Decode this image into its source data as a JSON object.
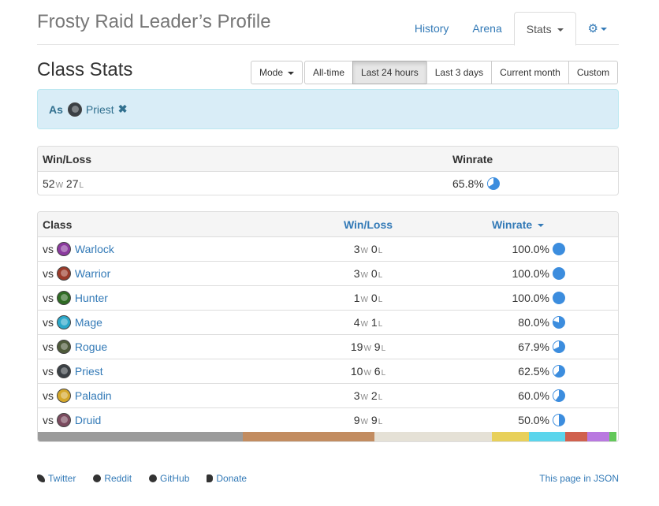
{
  "header": {
    "title": "Frosty Raid Leader’s Profile",
    "tabs": [
      {
        "label": "History"
      },
      {
        "label": "Arena"
      },
      {
        "label": "Stats"
      }
    ],
    "settings_icon": "gear-icon"
  },
  "toolbar": {
    "section_title": "Class Stats",
    "mode_label": "Mode",
    "ranges": [
      "All-time",
      "Last 24 hours",
      "Last 3 days",
      "Current month",
      "Custom"
    ],
    "active_range": "Last 24 hours"
  },
  "filter": {
    "as_label": "As",
    "class_name": "Priest",
    "class_icon": "priest-icon",
    "remove_icon": "✖"
  },
  "summary": {
    "headers": {
      "winloss": "Win/Loss",
      "winrate": "Winrate"
    },
    "wins": "52",
    "losses": "27",
    "win_unit": "W",
    "loss_unit": "L",
    "winrate": "65.8%",
    "winrate_fraction": 0.658
  },
  "classes": {
    "headers": {
      "class": "Class",
      "winloss": "Win/Loss",
      "winrate": "Winrate"
    },
    "vs_label": "vs",
    "rows": [
      {
        "name": "Warlock",
        "icon": "warlock-icon",
        "color": "#8b3a9e",
        "wins": "3",
        "losses": "0",
        "winrate": "100.0%",
        "fraction": 1.0
      },
      {
        "name": "Warrior",
        "icon": "warrior-icon",
        "color": "#9a3b2a",
        "wins": "3",
        "losses": "0",
        "winrate": "100.0%",
        "fraction": 1.0
      },
      {
        "name": "Hunter",
        "icon": "hunter-icon",
        "color": "#2f6b24",
        "wins": "1",
        "losses": "0",
        "winrate": "100.0%",
        "fraction": 1.0
      },
      {
        "name": "Mage",
        "icon": "mage-icon",
        "color": "#2aa7c9",
        "wins": "4",
        "losses": "1",
        "winrate": "80.0%",
        "fraction": 0.8
      },
      {
        "name": "Rogue",
        "icon": "rogue-icon",
        "color": "#4e5a3a",
        "wins": "19",
        "losses": "9",
        "winrate": "67.9%",
        "fraction": 0.679
      },
      {
        "name": "Priest",
        "icon": "priest-icon",
        "color": "#3a3f44",
        "wins": "10",
        "losses": "6",
        "winrate": "62.5%",
        "fraction": 0.625
      },
      {
        "name": "Paladin",
        "icon": "paladin-icon",
        "color": "#d4a72a",
        "wins": "3",
        "losses": "2",
        "winrate": "60.0%",
        "fraction": 0.6
      },
      {
        "name": "Druid",
        "icon": "druid-icon",
        "color": "#7a4a5e",
        "wins": "9",
        "losses": "9",
        "winrate": "50.0%",
        "fraction": 0.5
      }
    ],
    "distribution": [
      {
        "class": "Warrior",
        "share": 0.353,
        "color": "#9b9b9b"
      },
      {
        "class": "Rogue",
        "share": 0.227,
        "color": "#c28c60"
      },
      {
        "class": "Priest",
        "share": 0.202,
        "color": "#e5e1d6"
      },
      {
        "class": "Paladin",
        "share": 0.064,
        "color": "#e8d05a"
      },
      {
        "class": "Mage",
        "share": 0.063,
        "color": "#5bd5ec"
      },
      {
        "class": "Warlock",
        "share": 0.038,
        "color": "#d0614e"
      },
      {
        "class": "Druid",
        "share": 0.038,
        "color": "#b979e0"
      },
      {
        "class": "Hunter",
        "share": 0.013,
        "color": "#63c85a"
      }
    ]
  },
  "pie_color": "#3c8dde",
  "footer": {
    "links": [
      {
        "label": "Twitter",
        "icon": "twitter-icon"
      },
      {
        "label": "Reddit",
        "icon": "reddit-icon"
      },
      {
        "label": "GitHub",
        "icon": "github-icon"
      },
      {
        "label": "Donate",
        "icon": "paypal-icon"
      }
    ],
    "json_link": "This page in JSON"
  }
}
